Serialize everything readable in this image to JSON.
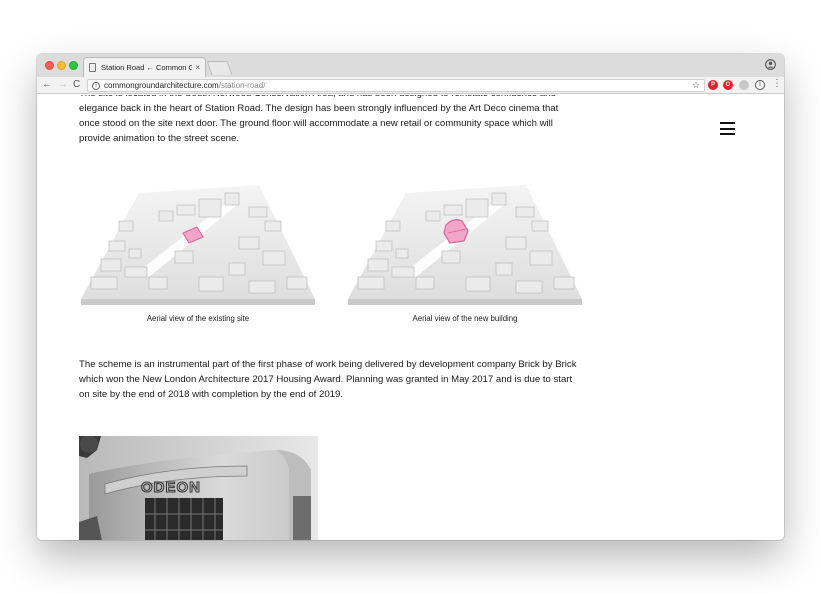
{
  "browser": {
    "tab_title": "Station Road ← Common Gro",
    "tab_close": "×",
    "url_domain": "commongroundarchitecture.com",
    "url_path": "/station-road/",
    "nav_back": "←",
    "nav_forward": "→",
    "nav_reload": "C",
    "info_icon": "i",
    "star": "☆",
    "menu": "⋮",
    "extensions": [
      "pinterest-icon",
      "opera-icon",
      "extension-icon",
      "info-icon"
    ]
  },
  "page": {
    "intro_text": "The site is located in the South Norwood Conservation Area, and has been designed to reinstate confidence and elegance back in the heart of Station Road. The design has been strongly influenced by the Art Deco cinema that once stood on the site next door. The ground floor will accommodate a new retail or community space which will provide animation to the street scene.",
    "figures": [
      {
        "caption": "Aerial view of the existing site"
      },
      {
        "caption": "Aerial view of the new building"
      }
    ],
    "scheme_text": "The scheme is an instrumental part of the first phase of work being delivered by development company Brick by Brick which won the New London Architecture 2017 Housing Award. Planning was granted in May 2017 and is due to start on site by the end of 2018 with completion by the end of 2019.",
    "photo_sign": "ODEON"
  },
  "colors": {
    "highlight": "#f2a5c8",
    "highlight_stroke": "#d6649a",
    "text": "#1a1a1a"
  }
}
